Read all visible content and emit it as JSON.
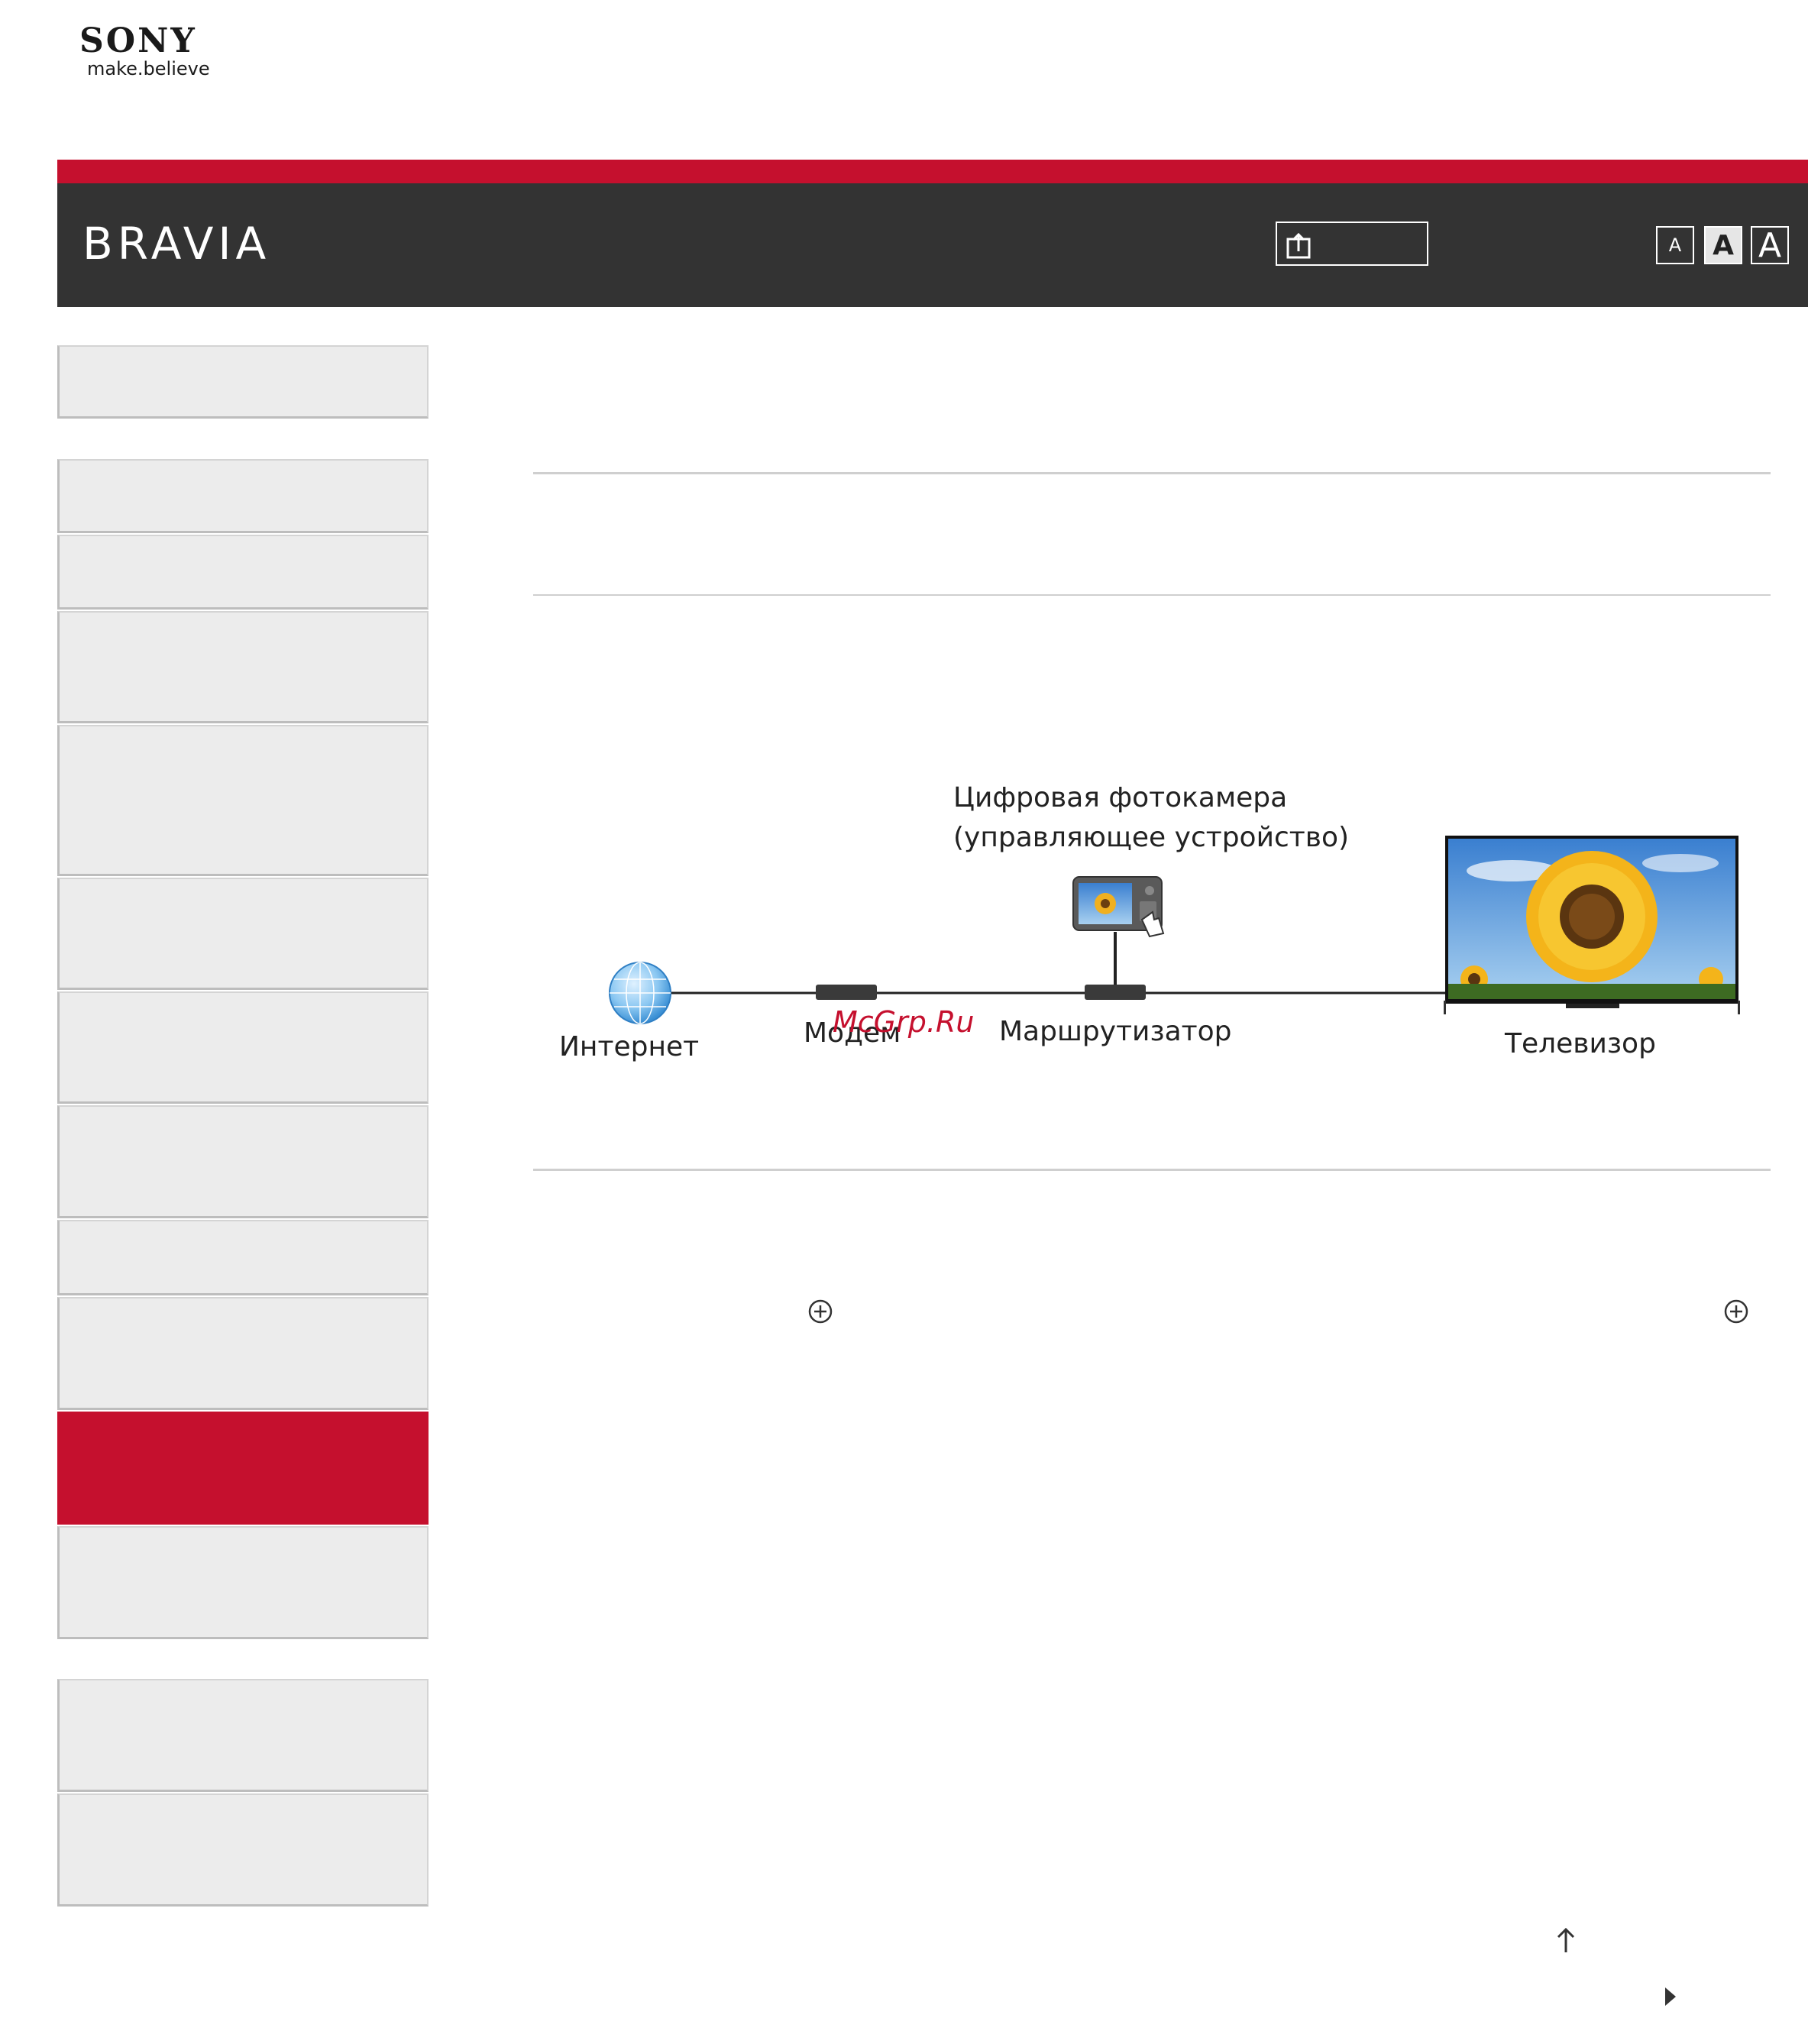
{
  "logo": {
    "brand": "SONY",
    "tagline": "make.believe"
  },
  "header": {
    "title": "BRAVIA"
  },
  "font_size_buttons": {
    "small": "A",
    "medium": "A",
    "large": "A",
    "selected": "medium"
  },
  "colors": {
    "accent": "#c5102e",
    "header_bg": "#333333",
    "nav_bg": "#ececec"
  },
  "sidebar": {
    "active_index": 11
  },
  "diagram": {
    "camera_label_line1": "Цифровая фотокамера",
    "camera_label_line2": "(управляющее устройство)",
    "internet": "Интернет",
    "modem": "Модем",
    "router": "Маршрутизатор",
    "tv": "Телевизор"
  },
  "watermark": "McGrp.Ru",
  "icons": {
    "share": "share-icon",
    "expand": "circle-plus-icon",
    "back_to_top": "arrow-up-icon",
    "next": "triangle-right-icon"
  }
}
